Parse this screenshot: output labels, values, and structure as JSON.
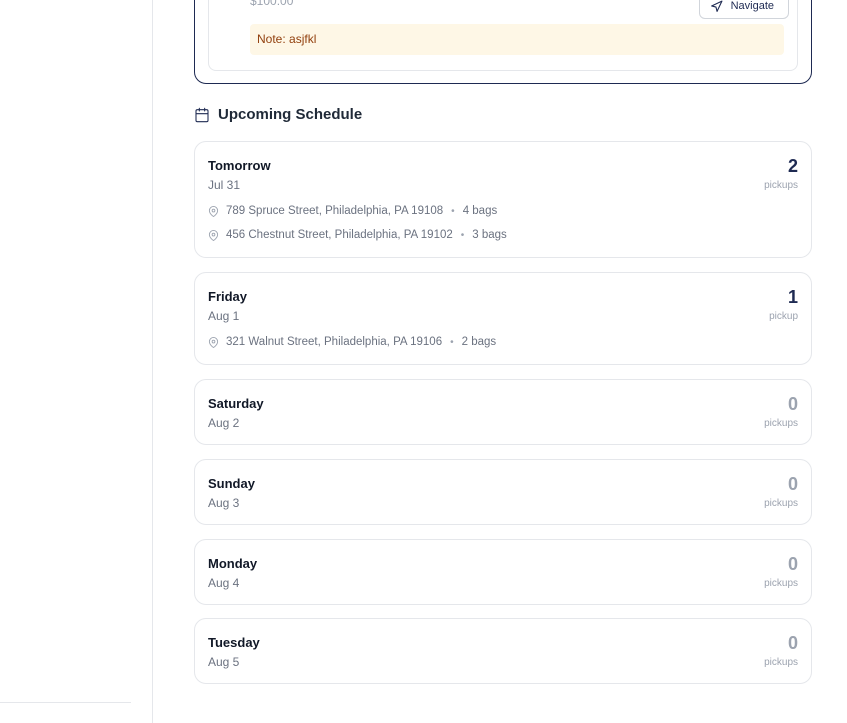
{
  "active_stop": {
    "price": "$100.00",
    "navigate_label": "Navigate",
    "note": "Note: asjfkl"
  },
  "schedule": {
    "title": "Upcoming Schedule",
    "days": [
      {
        "name": "Tomorrow",
        "date": "Jul 31",
        "count": "2",
        "count_label": "pickups",
        "pickups": [
          {
            "address": "789 Spruce Street, Philadelphia, PA 19108",
            "bags": "4 bags"
          },
          {
            "address": "456 Chestnut Street, Philadelphia, PA 19102",
            "bags": "3 bags"
          }
        ]
      },
      {
        "name": "Friday",
        "date": "Aug 1",
        "count": "1",
        "count_label": "pickup",
        "pickups": [
          {
            "address": "321 Walnut Street, Philadelphia, PA 19106",
            "bags": "2 bags"
          }
        ]
      },
      {
        "name": "Saturday",
        "date": "Aug 2",
        "count": "0",
        "count_label": "pickups"
      },
      {
        "name": "Sunday",
        "date": "Aug 3",
        "count": "0",
        "count_label": "pickups"
      },
      {
        "name": "Monday",
        "date": "Aug 4",
        "count": "0",
        "count_label": "pickups"
      },
      {
        "name": "Tuesday",
        "date": "Aug 5",
        "count": "0",
        "count_label": "pickups"
      }
    ]
  },
  "colors": {
    "primary": "#1e2a52",
    "muted": "#9ca3af",
    "note_bg": "#fef7e6",
    "note_text": "#92400e"
  }
}
